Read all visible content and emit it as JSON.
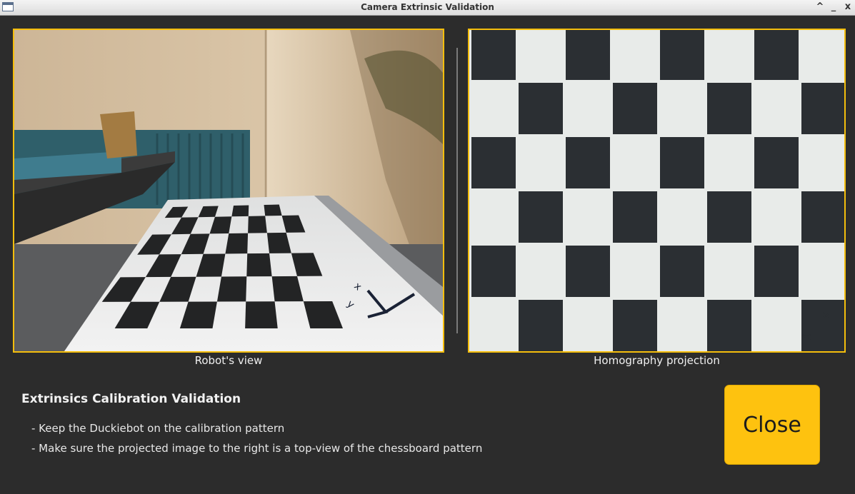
{
  "window": {
    "title": "Camera Extrinsic Validation",
    "controls": [
      "^",
      "_",
      "x"
    ]
  },
  "left_panel": {
    "caption": "Robot's view"
  },
  "right_panel": {
    "caption": "Homography projection"
  },
  "info": {
    "heading": "Extrinsics Calibration Validation",
    "instructions": [
      "- Keep the Duckiebot on the calibration pattern",
      "- Make sure the projected image to the right is a top-view of the chessboard pattern"
    ]
  },
  "close_button": {
    "label": "Close"
  },
  "colors": {
    "accent": "#f5be0c",
    "button": "#fec20f",
    "background": "#2c2c2c"
  }
}
